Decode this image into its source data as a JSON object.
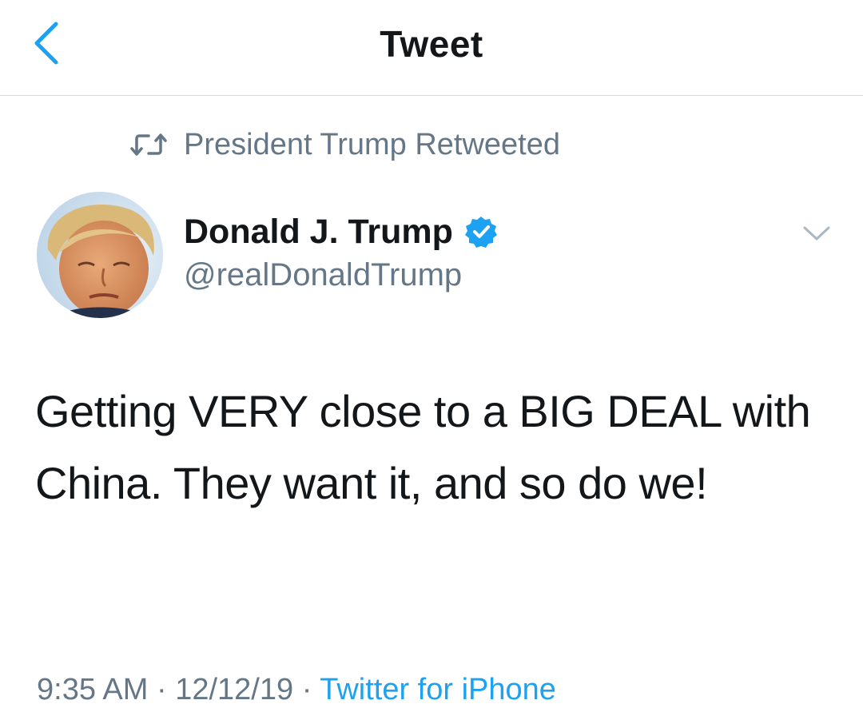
{
  "header": {
    "title": "Tweet",
    "back_icon": "chevron-left-icon",
    "accent_color": "#1da1f2"
  },
  "retweet_context": {
    "icon": "retweet-icon",
    "text": "President Trump Retweeted"
  },
  "author": {
    "name": "Donald J. Trump",
    "handle": "@realDonaldTrump",
    "verified": true,
    "verified_icon": "verified-badge-icon",
    "avatar": "avatar-photo"
  },
  "menu": {
    "icon": "chevron-down-icon"
  },
  "tweet": {
    "text": "Getting VERY close to a BIG DEAL with China. They want it, and so do we!"
  },
  "meta": {
    "time": "9:35 AM",
    "separator": "·",
    "date": "12/12/19",
    "source": "Twitter for iPhone"
  },
  "colors": {
    "primary_text": "#14171a",
    "secondary_text": "#657786",
    "link": "#1da1f2",
    "divider": "#d6d9dc"
  }
}
